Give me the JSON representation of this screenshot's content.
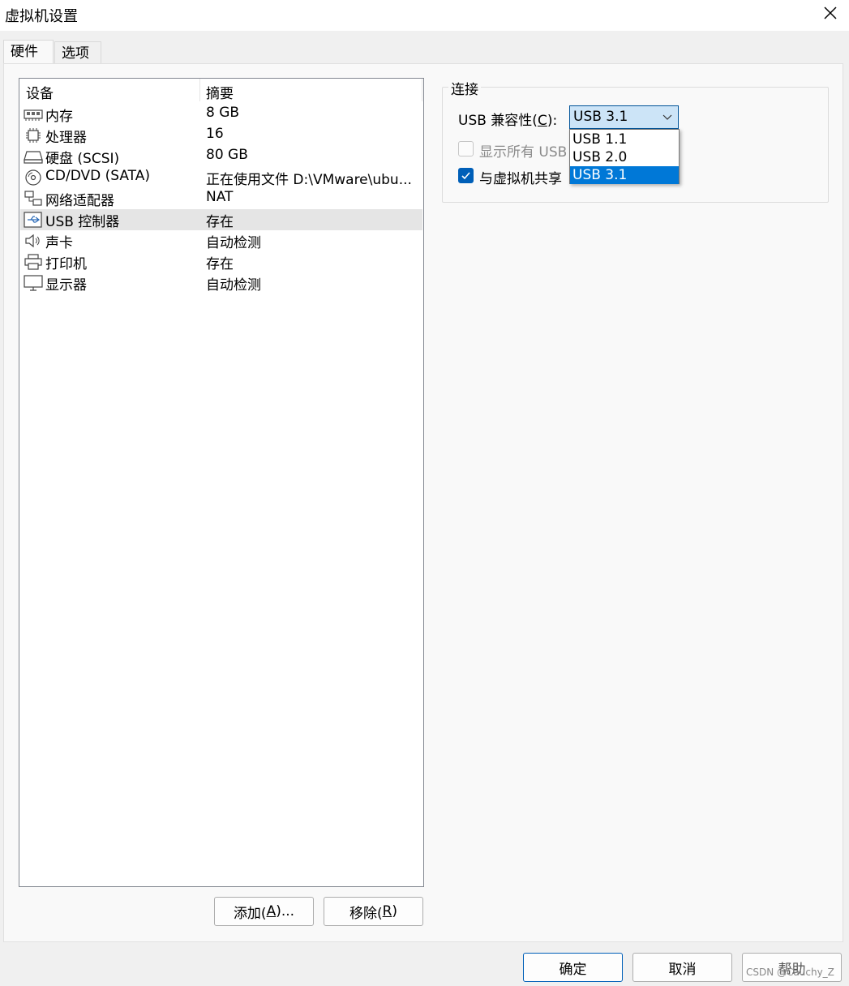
{
  "window": {
    "title": "虚拟机设置"
  },
  "tabs": [
    {
      "label": "硬件",
      "active": true
    },
    {
      "label": "选项",
      "active": false
    }
  ],
  "device_list": {
    "header_device": "设备",
    "header_summary": "摘要",
    "rows": [
      {
        "name": "内存",
        "summary": "8 GB",
        "icon": "memory-icon"
      },
      {
        "name": "处理器",
        "summary": "16",
        "icon": "processor-icon"
      },
      {
        "name": "硬盘 (SCSI)",
        "summary": "80 GB",
        "icon": "harddisk-icon"
      },
      {
        "name": "CD/DVD (SATA)",
        "summary": "正在使用文件 D:\\VMware\\ubu...",
        "icon": "cd-dvd-icon"
      },
      {
        "name": "网络适配器",
        "summary": "NAT",
        "icon": "network-adapter-icon"
      },
      {
        "name": "USB 控制器",
        "summary": "存在",
        "icon": "usb-icon",
        "selected": true
      },
      {
        "name": "声卡",
        "summary": "自动检测",
        "icon": "speaker-icon"
      },
      {
        "name": "打印机",
        "summary": "存在",
        "icon": "printer-icon"
      },
      {
        "name": "显示器",
        "summary": "自动检测",
        "icon": "monitor-icon"
      }
    ]
  },
  "buttons": {
    "add": {
      "text": "添加(",
      "key": "A",
      "suffix": ")..."
    },
    "remove": {
      "text": "移除(",
      "key": "R",
      "suffix": ")"
    },
    "ok": "确定",
    "cancel": "取消",
    "help": "帮助"
  },
  "connection": {
    "group_title": "连接",
    "compat_label": "USB 兼容性(",
    "compat_key": "C",
    "compat_suffix": "):",
    "selected_value": "USB 3.1",
    "options": [
      "USB 1.1",
      "USB 2.0",
      "USB 3.1"
    ],
    "show_all_usb_label": "显示所有 USB",
    "show_all_usb_checked": false,
    "share_label": "与虚拟机共享",
    "share_checked": true
  },
  "watermark": "CSDN @Cauchy_Z",
  "colors": {
    "accent": "#005fb8",
    "select_highlight": "#0078d7",
    "selected_row": "#e5e5e5"
  }
}
